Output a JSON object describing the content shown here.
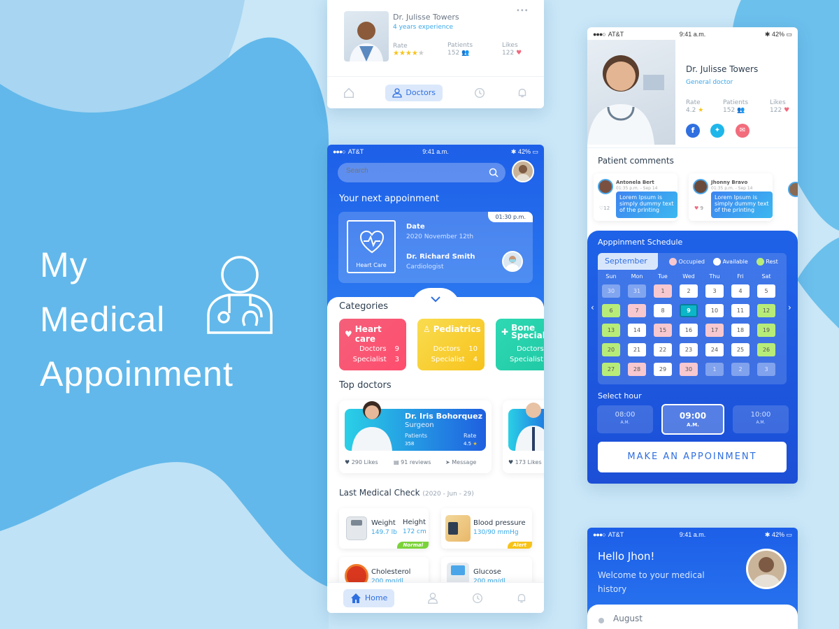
{
  "hero": {
    "line1": "My",
    "line2": "Medical",
    "line3": "Appoinment"
  },
  "colors": {
    "primary": "#1f5fe0",
    "accent": "#2f7ff0",
    "heart": "#f0617a",
    "peds": "#f8d23a",
    "bones": "#26d6b0",
    "occupied": "#f7c8cf",
    "rest": "#b8ec79"
  },
  "card_top": {
    "name": "Dr. Julisse Towers",
    "exp": "4 years experience",
    "rate_label": "Rate",
    "patients_label": "Patients",
    "patients": "152",
    "likes_label": "Likes",
    "likes": "122",
    "nav_doctors": "Doctors",
    "menu": "•••"
  },
  "home": {
    "status": {
      "carrier": "AT&T",
      "time": "9:41 a.m.",
      "battery": "42%"
    },
    "search_placeholder": "Search",
    "next_title": "Your next appoinment",
    "appt": {
      "time": "01:30 p.m.",
      "icon_label": "Heart Care",
      "date_label": "Date",
      "date": "2020 November 12th",
      "doctor": "Dr. Richard Smith",
      "specialty": "Cardiologist"
    },
    "categories_title": "Categories",
    "categories": [
      {
        "name": "Heart care",
        "doctors_label": "Doctors",
        "doctors": "9",
        "spec_label": "Specialist",
        "spec": "3"
      },
      {
        "name": "Pediatrics",
        "doctors_label": "Doctors",
        "doctors": "10",
        "spec_label": "Specialist",
        "spec": "4"
      },
      {
        "name": "Bone Special",
        "doctors_label": "Doctors",
        "spec_label": "Specialist"
      }
    ],
    "top_title": "Top doctors",
    "top_doctor": {
      "name": "Dr. Iris Bohorquez",
      "spec": "Surgeon",
      "patients_label": "Patients",
      "patients": "358",
      "rate_label": "Rate",
      "rate": "4.5",
      "likes": "290 Likes",
      "reviews": "91 reviews",
      "message": "Message"
    },
    "second_likes": "173 Likes",
    "check_title": "Last Medical Check",
    "check_date": "(2020 - Jun - 29)",
    "checks": {
      "weight_label": "Weight",
      "weight": "149.7 lb",
      "height_label": "Height",
      "height": "172 cm",
      "tag1": "Normal",
      "bp_label": "Blood pressure",
      "bp": "130/90 mmHg",
      "tag2": "Alert",
      "chol_label": "Cholesterol",
      "chol": "200 mg/dl",
      "glu_label": "Glucose",
      "glu": "200 mg/dl"
    },
    "nav_home": "Home"
  },
  "profile": {
    "status": {
      "carrier": "AT&T",
      "time": "9:41 a.m.",
      "battery": "42%"
    },
    "name": "Dr. Julisse Towers",
    "spec": "General doctor",
    "rate_label": "Rate",
    "rate": "4.2",
    "patients_label": "Patients",
    "patients": "152",
    "likes_label": "Likes",
    "likes": "122",
    "comments_title": "Patient comments",
    "comments": [
      {
        "name": "Antonela Bert",
        "date": "01:35 p.m. - Sep 14",
        "text": "Lorem Ipsum is simply dummy text of the printing",
        "likes": "12"
      },
      {
        "name": "Jhonny Bravo",
        "date": "01:35 p.m. - Sep 14",
        "text": "Lorem Ipsum is simply dummy text of the printing",
        "likes": "9"
      }
    ],
    "schedule_title": "Apppinment Schedule",
    "month": "September",
    "legend": {
      "occupied": "Occupied",
      "available": "Available",
      "rest": "Rest"
    },
    "weekdays": [
      "Sun",
      "Mon",
      "Tue",
      "Wed",
      "Thu",
      "Fri",
      "Sat"
    ],
    "days": [
      "30",
      "31",
      "1",
      "2",
      "3",
      "4",
      "5",
      "6",
      "7",
      "8",
      "9",
      "10",
      "11",
      "12",
      "13",
      "14",
      "15",
      "16",
      "17",
      "18",
      "19",
      "20",
      "21",
      "22",
      "23",
      "24",
      "25",
      "26",
      "27",
      "28",
      "29",
      "30",
      "1",
      "2",
      "3"
    ],
    "select_hour": "Select hour",
    "hours": [
      {
        "t": "08:00",
        "s": "A.M."
      },
      {
        "t": "09:00",
        "s": "A.M."
      },
      {
        "t": "10:00",
        "s": "A.M."
      }
    ],
    "cta": "MAKE AN APPOINMENT"
  },
  "history": {
    "status": {
      "carrier": "AT&T",
      "time": "9:41 a.m.",
      "battery": "42%"
    },
    "hello": "Hello Jhon!",
    "welcome": "Welcome to your medical history",
    "month": "August"
  }
}
